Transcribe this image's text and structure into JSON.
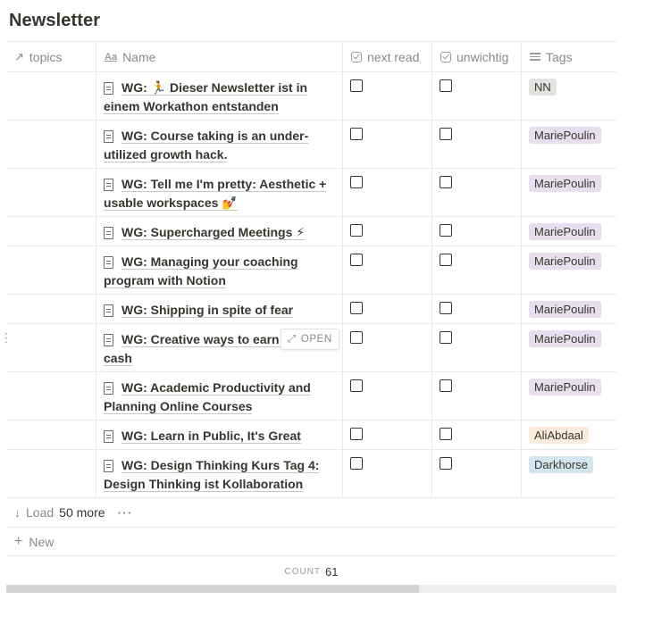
{
  "page": {
    "title": "Newsletter"
  },
  "columns": [
    {
      "label": "topics",
      "icon": "arrow-up-right-icon"
    },
    {
      "label": "Name",
      "icon": "text-aa-icon"
    },
    {
      "label": "next read",
      "icon": "checkbox-icon"
    },
    {
      "label": "unwichtig",
      "icon": "checkbox-icon"
    },
    {
      "label": "Tags",
      "icon": "list-icon"
    }
  ],
  "rows": [
    {
      "name_line1": "WG: 🏃 Dieser Newsletter ist in",
      "name_line2": "einem Workathon entstanden",
      "tag": "NN",
      "tag_color": "#e3e2e0"
    },
    {
      "name_line1": "WG: Course taking is an under-",
      "name_line2": "utilized growth hack.",
      "tag": "MariePoulin",
      "tag_color": "#e8deee"
    },
    {
      "name_line1": "WG: Tell me I'm pretty: Aesthetic +",
      "name_line2": "usable workspaces 💅",
      "tag": "MariePoulin",
      "tag_color": "#e8deee"
    },
    {
      "name_line1": "WG: Supercharged Meetings ⚡",
      "name_line2": "",
      "tag": "MariePoulin",
      "tag_color": "#e8deee"
    },
    {
      "name_line1": "WG: Managing your coaching",
      "name_line2": "program with Notion",
      "tag": "MariePoulin",
      "tag_color": "#e8deee"
    },
    {
      "name_line1": "WG: Shipping in spite of fear",
      "name_line2": "",
      "tag": "MariePoulin",
      "tag_color": "#e8deee"
    },
    {
      "name_line1": "WG: Creative ways to earn s",
      "name_line2": "cash",
      "tag": "MariePoulin",
      "tag_color": "#e8deee"
    },
    {
      "name_line1": "WG: Academic Productivity and",
      "name_line2": "Planning Online Courses",
      "tag": "MariePoulin",
      "tag_color": "#e8deee"
    },
    {
      "name_line1": "WG: Learn in Public, It's Great",
      "name_line2": "",
      "tag": "AliAbdaal",
      "tag_color": "#fbecdd"
    },
    {
      "name_line1": "WG: Design Thinking Kurs Tag 4:",
      "name_line2": "Design Thinking ist Kollaboration",
      "tag": "Darkhorse",
      "tag_color": "#d3e5ef"
    }
  ],
  "open_button": {
    "label": "OPEN",
    "icon": "expand-arrows-icon"
  },
  "footer": {
    "load_prefix": "Load",
    "load_count": "50 more",
    "more_icon": "ellipsis-icon",
    "new_label": "New",
    "count_label": "COUNT",
    "count_value": "61"
  },
  "scroll": {
    "visible_fraction": 0.677
  }
}
